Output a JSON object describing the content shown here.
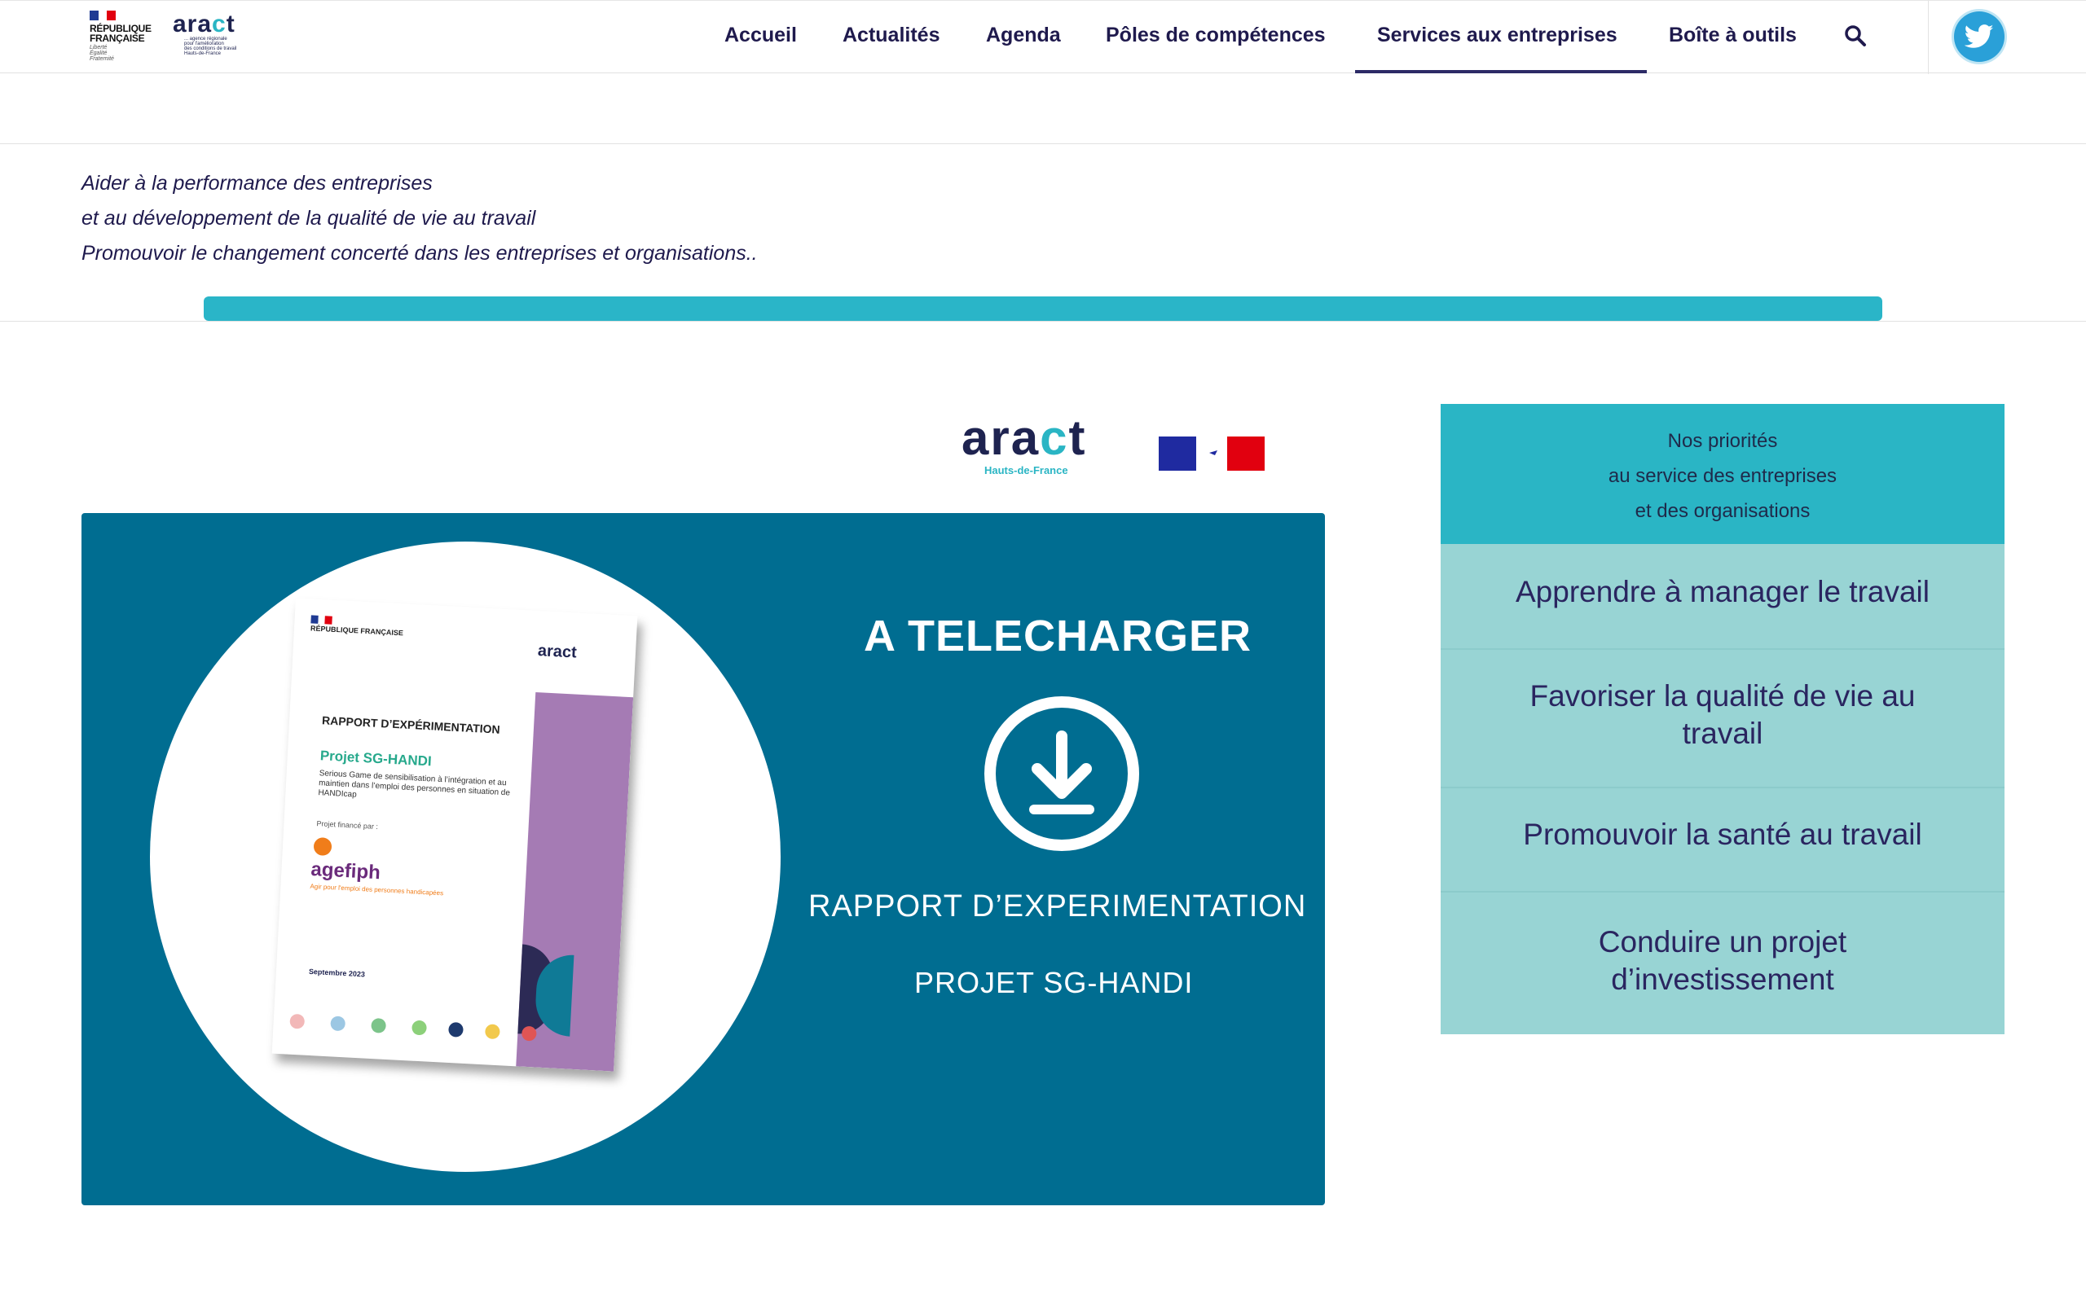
{
  "header": {
    "rf_logo": {
      "line1": "RÉPUBLIQUE",
      "line2": "FRANÇAISE",
      "motto": [
        "Liberté",
        "Égalité",
        "Fraternité"
      ]
    },
    "aract_logo": {
      "word_start": "ara",
      "word_accent": "c",
      "word_end": "t",
      "sub": [
        "... agence régionale",
        "pour l'amélioration",
        "des conditions de travail",
        "Hauts-de-France"
      ]
    },
    "nav": [
      {
        "label": "Accueil",
        "active": false
      },
      {
        "label": "Actualités",
        "active": false
      },
      {
        "label": "Agenda",
        "active": false
      },
      {
        "label": "Pôles de compétences",
        "active": false
      },
      {
        "label": "Services aux entreprises",
        "active": true
      },
      {
        "label": "Boîte à outils",
        "active": false
      }
    ],
    "search_icon": "search-icon",
    "social": {
      "icon": "twitter-icon",
      "color": "#2aa0d8"
    }
  },
  "intro": {
    "lines": [
      "Aider à la performance des entreprises",
      "et au développement de la qualité de vie au travail",
      "Promouvoir le changement concerté dans les entreprises et organisations.."
    ],
    "progress": 1.0,
    "accent": "#2ab5c8"
  },
  "banner_logos": {
    "aract": {
      "word_start": "ara",
      "word_accent": "c",
      "word_end": "t",
      "region": "Hauts-de-France"
    }
  },
  "banner": {
    "background": "#006d91",
    "title": "A TELECHARGER",
    "icon": "download-icon",
    "subtitle": "RAPPORT D’EXPERIMENTATION",
    "project": "PROJET SG-HANDI",
    "document": {
      "rf": "RÉPUBLIQUE FRANÇAISE",
      "aract": "aract",
      "heading": "RAPPORT D’EXPÉRIMENTATION",
      "project": "Projet SG-HANDI",
      "description": "Serious Game de sensibilisation à l’intégration et au maintien dans l’emploi des personnes en situation de HANDIcap",
      "financed_by": "Projet financé par :",
      "funder": "agefiph",
      "funder_sub": "Agir pour l'emploi des personnes handicapées",
      "date": "Septembre 2023"
    }
  },
  "priorities": {
    "header_lines": [
      "Nos priorités",
      "au service des entreprises",
      "et des organisations"
    ],
    "items": [
      "Apprendre à manager le travail",
      "Favoriser la qualité de vie au travail",
      "Promouvoir la santé au travail",
      "Conduire un projet d’investissement"
    ],
    "colors": {
      "header": "#2ab5c5",
      "list": "#98d4d4"
    }
  }
}
